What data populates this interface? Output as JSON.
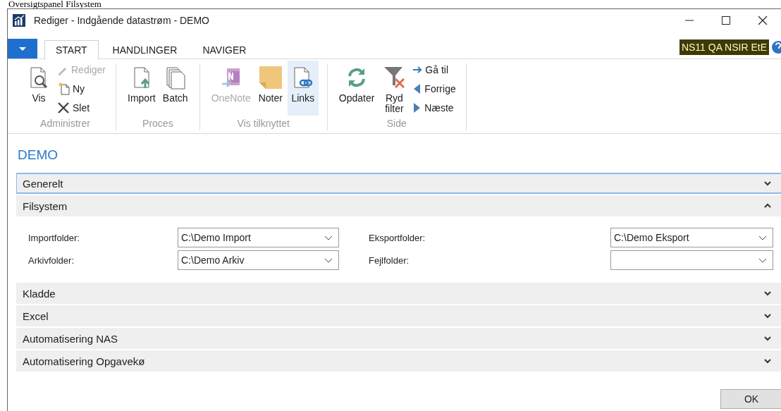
{
  "page_caption": "Oversigtspanel Filsystem",
  "window": {
    "title": "Rediger - Indgående datastrøm - DEMO"
  },
  "tabs": [
    {
      "label": "START",
      "selected": true
    },
    {
      "label": "HANDLINGER",
      "selected": false
    },
    {
      "label": "NAVIGER",
      "selected": false
    }
  ],
  "company_badge": "NS11 QA NSIR EtE",
  "ribbon_groups": [
    {
      "label": "Administrer",
      "actions": [
        {
          "kind": "large",
          "label": "Vis",
          "disabled": false,
          "selected": false
        },
        {
          "kind": "small",
          "label": "Rediger",
          "disabled": true
        },
        {
          "kind": "small",
          "label": "Ny",
          "disabled": false
        },
        {
          "kind": "small",
          "label": "Slet",
          "disabled": false
        }
      ]
    },
    {
      "label": "Proces",
      "actions": [
        {
          "kind": "large",
          "label": "Import",
          "disabled": false,
          "selected": false
        },
        {
          "kind": "large",
          "label": "Batch",
          "disabled": false,
          "selected": false
        }
      ]
    },
    {
      "label": "Vis tilknyttet",
      "actions": [
        {
          "kind": "large",
          "label": "OneNote",
          "disabled": true,
          "selected": false
        },
        {
          "kind": "large",
          "label": "Noter",
          "disabled": false,
          "selected": false
        },
        {
          "kind": "large",
          "label": "Links",
          "disabled": false,
          "selected": true
        }
      ]
    },
    {
      "label": "Side",
      "actions": [
        {
          "kind": "large",
          "label": "Opdater",
          "disabled": false,
          "selected": false
        },
        {
          "kind": "large",
          "label": "Ryd filter",
          "disabled": false,
          "selected": false
        },
        {
          "kind": "small",
          "label": "Gå til",
          "disabled": false
        },
        {
          "kind": "small",
          "label": "Forrige",
          "disabled": false
        },
        {
          "kind": "small",
          "label": "Næste",
          "disabled": false
        }
      ]
    }
  ],
  "page_title": "DEMO",
  "sections": [
    {
      "title": "Generelt",
      "expanded": false,
      "focused": true
    },
    {
      "title": "Filsystem",
      "expanded": true,
      "focused": false,
      "fields": [
        {
          "label": "Importfolder:",
          "value": "C:\\Demo Import"
        },
        {
          "label": "Eksportfolder:",
          "value": "C:\\Demo Eksport"
        },
        {
          "label": "Arkivfolder:",
          "value": "C:\\Demo Arkiv"
        },
        {
          "label": "Fejlfolder:"
        }
      ]
    },
    {
      "title": "Kladde",
      "expanded": false,
      "focused": false
    },
    {
      "title": "Excel",
      "expanded": false,
      "focused": false
    },
    {
      "title": "Automatisering NAS",
      "expanded": false,
      "focused": false
    },
    {
      "title": "Automatisering Opgavekø",
      "expanded": false,
      "focused": false
    }
  ],
  "buttons": [
    "OK"
  ]
}
